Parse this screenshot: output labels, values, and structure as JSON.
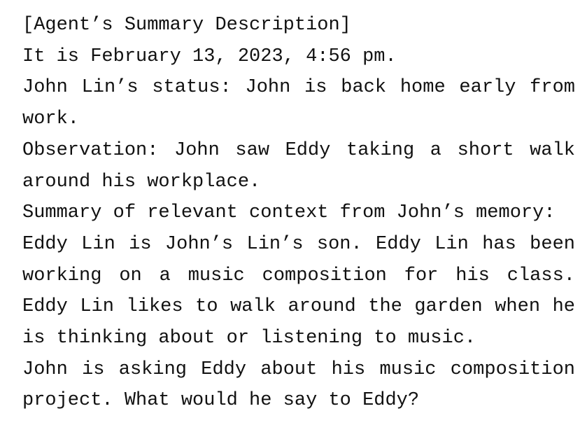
{
  "document": {
    "heading": "[Agent’s Summary Description]",
    "timestamp": "It is February 13, 2023, 4:56 pm.",
    "status": "John Lin’s status: John is back home early from work.",
    "observation": "Observation: John saw Eddy taking a short walk around his workplace.",
    "summary_heading": "Summary of relevant context from John’s memory:",
    "summary": "Eddy Lin is John’s Lin’s son. Eddy Lin has been working on a music composition for his class. Eddy Lin likes to walk around the garden when he is thinking about or listening to music.",
    "question": "John is asking Eddy about his music composition project. What would he say to Eddy?"
  }
}
